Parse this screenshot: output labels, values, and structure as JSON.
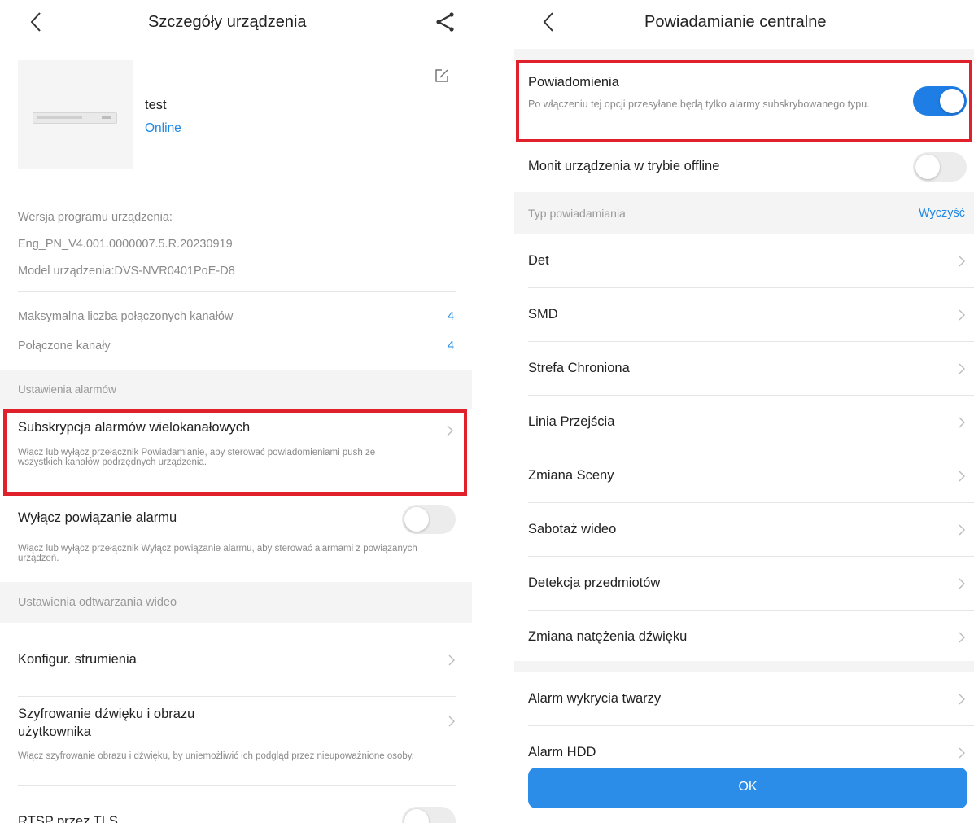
{
  "left": {
    "title": "Szczegóły urządzenia",
    "device": {
      "name": "test",
      "status": "Online"
    },
    "info": {
      "version_label": "Wersja programu urządzenia:",
      "version_value": "Eng_PN_V4.001.0000007.5.R.20230919",
      "model": "Model urządzenia:DVS-NVR0401PoE-D8"
    },
    "channels": {
      "max_label": "Maksymalna liczba połączonych kanałów",
      "max_value": "4",
      "connected_label": "Połączone kanały",
      "connected_value": "4"
    },
    "alarm_section": "Ustawienia alarmów",
    "subscription": {
      "title": "Subskrypcja alarmów wielokanałowych",
      "desc": "Włącz lub wyłącz przełącznik Powiadamianie, aby sterować powiadomieniami push ze wszystkich kanałów podrzędnych urządzenia."
    },
    "disable_link": {
      "title": "Wyłącz powiązanie alarmu",
      "desc": "Włącz lub wyłącz przełącznik Wyłącz powiązanie alarmu, aby sterować alarmami z powiązanych urządzeń.",
      "enabled": false
    },
    "playback_section": "Ustawienia odtwarzania wideo",
    "stream_config": "Konfigur. strumienia",
    "encryption": {
      "title_line1": "Szyfrowanie dźwięku i obrazu",
      "title_line2": "użytkownika",
      "desc": "Włącz szyfrowanie obrazu i dźwięku, by uniemożliwić ich podgląd przez nieupoważnione osoby."
    },
    "rtsp": {
      "title": "RTSP przez TLS",
      "enabled": false
    }
  },
  "right": {
    "title": "Powiadamianie centralne",
    "notifications": {
      "title": "Powiadomienia",
      "desc": "Po włączeniu tej opcji przesyłane będą tylko alarmy subskrybowanego typu.",
      "enabled": true
    },
    "offline": {
      "title": "Monit urządzenia w trybie offline",
      "enabled": false
    },
    "type_header": "Typ powiadamiania",
    "clear": "Wyczyść",
    "types": [
      "Det",
      "SMD",
      "Strefa Chroniona",
      "Linia Przejścia",
      "Zmiana Sceny",
      "Sabotaż wideo",
      "Detekcja przedmiotów",
      "Zmiana natężenia dźwięku"
    ],
    "types2": [
      "Alarm wykrycia twarzy",
      "Alarm HDD"
    ],
    "ok": "OK"
  },
  "colors": {
    "accent": "#1e88e5",
    "highlight": "#e0202b",
    "section_bg": "#f4f4f4"
  }
}
